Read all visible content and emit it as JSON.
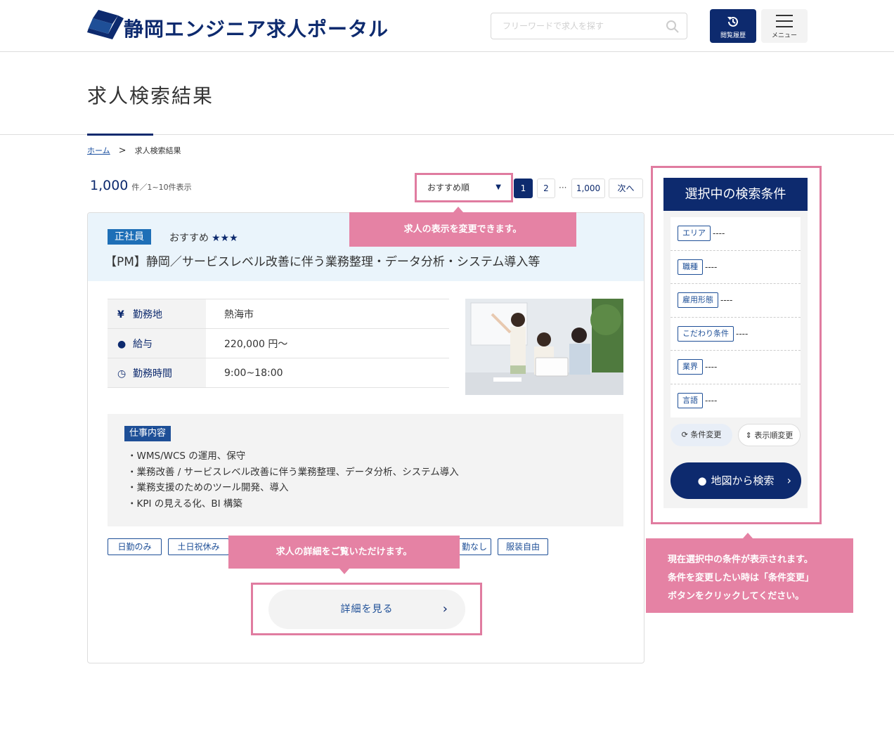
{
  "header": {
    "logo_text": "静岡エンジニア求人ポータル",
    "search_placeholder": "フリーワードで求人を探す",
    "history_label": "閲覧履歴",
    "menu_label": "メニュー",
    "brand_color": "#0d2a6e"
  },
  "page": {
    "title": "求人検索結果",
    "breadcrumb": {
      "home": "ホーム",
      "sep": ">",
      "current": "求人検索結果"
    }
  },
  "results": {
    "count": "1,000",
    "range": "件／1~10件表示",
    "sort_label": "おすすめ順",
    "pagination": {
      "p1": "1",
      "p2": "2",
      "ellipsis": "···",
      "last": "1,000",
      "next": "次へ"
    }
  },
  "tooltips": {
    "sort": "求人の表示を変更できます。",
    "detail": "求人の詳細をご覧いただけます。",
    "conditions_1": "現在選択中の条件が表示されます。",
    "conditions_2": "条件を変更したい時は「条件変更」",
    "conditions_3": "ボタンをクリックしてください。"
  },
  "job": {
    "type": "正社員",
    "recommend_label": "おすすめ",
    "stars": "★★★",
    "title": "【PM】静岡／サービスレベル改善に伴う業務整理・データ分析・システム導入等",
    "info": [
      {
        "icon": "yen-icon",
        "glyph": "¥",
        "key": "勤務地",
        "value": "熱海市"
      },
      {
        "icon": "location-pin-icon",
        "glyph": "●",
        "key": "給与",
        "value": "220,000 円〜"
      },
      {
        "icon": "clock-icon",
        "glyph": "◷",
        "key": "勤務時間",
        "value": "9:00~18:00"
      }
    ],
    "work_label": "仕事内容",
    "work_items": [
      "・WMS/WCS の運用、保守",
      "・業務改善 / サービスレベル改善に伴う業務整理、データ分析、システム導入",
      "・業務支援のためのツール開発、導入",
      "・KPI の見える化、BI 構築"
    ],
    "tags": [
      "日勤のみ",
      "土日祝休み",
      "勤なし",
      "服装自由"
    ],
    "detail_button": "詳細を見る"
  },
  "sidebar": {
    "title": "選択中の検索条件",
    "conditions": [
      {
        "label": "エリア",
        "value": "----"
      },
      {
        "label": "職種",
        "value": "----"
      },
      {
        "label": "雇用形態",
        "value": "----"
      },
      {
        "label": "こだわり条件",
        "value": "----"
      },
      {
        "label": "業界",
        "value": "----"
      },
      {
        "label": "言語",
        "value": "----"
      }
    ],
    "change_button": "条件変更",
    "order_button": "表示順変更",
    "map_button": "地図から検索"
  }
}
